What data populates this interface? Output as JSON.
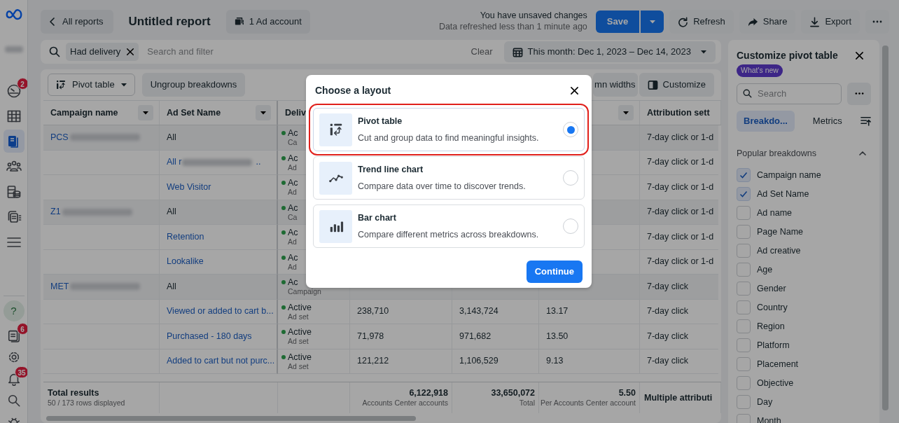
{
  "rail": {
    "top": [
      {
        "selected": false,
        "badge": "2"
      },
      {
        "selected": false
      },
      {
        "selected": true
      },
      {
        "selected": false
      },
      {
        "selected": false
      },
      {
        "selected": false
      },
      {
        "selected": false
      }
    ],
    "help": "?",
    "bottom": [
      {
        "selected": false,
        "badge": "6"
      },
      {
        "selected": false
      },
      {
        "selected": false,
        "badge": "35"
      },
      {
        "selected": false
      },
      {
        "selected": false
      }
    ]
  },
  "header": {
    "back": "All reports",
    "title": "Untitled report",
    "account": "1 Ad account",
    "status": "You have unsaved changes",
    "refreshed": "Data refreshed less than 1 minute ago",
    "save": "Save",
    "actions": [
      "Refresh",
      "Share",
      "Export"
    ]
  },
  "filter": {
    "chips": [
      "Had delivery"
    ],
    "placeholder": "Search and filter",
    "clear": "Clear",
    "date": "This month: Dec 1, 2023 – Dec 14, 2023"
  },
  "toolbar": {
    "layout": "Pivot table",
    "ungroup": "Ungroup breakdowns",
    "widths": "mn widths",
    "customize": "Customize"
  },
  "table": {
    "columns": [
      "Campaign name",
      "Ad Set Name",
      "Deliv",
      "Attribution sett"
    ],
    "rows": [
      {
        "kind": "summary",
        "campaign": "PCS",
        "redacted": true,
        "ad_set": "All",
        "delivery": "Ac",
        "delivery_sub": "Ca",
        "values": [],
        "attribution": "7-day click or 1-d"
      },
      {
        "kind": "adset",
        "ad_set": "All r",
        "ad_set_redacted": true,
        "ad_set_tail": "..",
        "delivery": "Ac",
        "delivery_sub": "Ad",
        "values": [],
        "attribution": "7-day click or 1-d"
      },
      {
        "kind": "adset",
        "ad_set": "Web Visitor",
        "delivery": "Ac",
        "delivery_sub": "Ad",
        "values": [],
        "attribution": "7-day click or 1-d"
      },
      {
        "kind": "summary",
        "campaign": "Z1",
        "redacted": true,
        "ad_set": "All",
        "delivery": "Ac",
        "delivery_sub": "Ca",
        "values": [],
        "attribution": "7-day click or 1-d"
      },
      {
        "kind": "adset",
        "ad_set": "Retention",
        "delivery": "Ac",
        "delivery_sub": "Ad",
        "values": [],
        "attribution": "7-day click or 1-d"
      },
      {
        "kind": "adset",
        "ad_set": "Lookalike",
        "delivery": "Ac",
        "delivery_sub": "Ad",
        "values": [],
        "attribution": "7-day click or 1-d"
      },
      {
        "kind": "summary",
        "campaign": "MET",
        "redacted": true,
        "ad_set": "All",
        "delivery": "Ac",
        "delivery_sub": "Campaign",
        "values": [],
        "attribution": "7-day click"
      },
      {
        "kind": "adset",
        "ad_set": "Viewed or added to cart b...",
        "delivery": "Active",
        "delivery_sub": "Ad set",
        "values": [
          "238,710",
          "3,143,724",
          "13.17"
        ],
        "attribution": "7-day click"
      },
      {
        "kind": "adset",
        "ad_set": "Purchased - 180 days",
        "delivery": "Active",
        "delivery_sub": "Ad set",
        "values": [
          "71,978",
          "971,682",
          "13.50"
        ],
        "attribution": "7-day click"
      },
      {
        "kind": "adset",
        "ad_set": "Added to cart but not purc...",
        "delivery": "Active",
        "delivery_sub": "Ad set",
        "values": [
          "121,212",
          "1,106,529",
          "9.13"
        ],
        "attribution": "7-day click"
      }
    ],
    "totals": {
      "label": "Total results",
      "sub": "50 / 173 rows displayed",
      "cells": [
        {
          "value": "6,122,918",
          "sub": "Accounts Center accounts"
        },
        {
          "value": "33,650,072",
          "sub": "Total"
        },
        {
          "value": "5.50",
          "sub": "Per Accounts Center account"
        }
      ],
      "attribution": "Multiple attributi"
    }
  },
  "panel": {
    "title": "Customize pivot table",
    "badge": "What's new",
    "search_placeholder": "Search",
    "tabs": [
      {
        "label": "Breakdo...",
        "selected": true
      },
      {
        "label": "Metrics",
        "selected": false
      }
    ],
    "section": "Popular breakdowns",
    "expanded": true,
    "breakdowns": [
      {
        "label": "Campaign name",
        "checked": true
      },
      {
        "label": "Ad Set Name",
        "checked": true
      },
      {
        "label": "Ad name",
        "checked": false
      },
      {
        "label": "Page Name",
        "checked": false
      },
      {
        "label": "Ad creative",
        "checked": false
      },
      {
        "label": "Age",
        "checked": false
      },
      {
        "label": "Gender",
        "checked": false
      },
      {
        "label": "Country",
        "checked": false
      },
      {
        "label": "Region",
        "checked": false
      },
      {
        "label": "Platform",
        "checked": false
      },
      {
        "label": "Placement",
        "checked": false
      },
      {
        "label": "Objective",
        "checked": false
      },
      {
        "label": "Day",
        "checked": false
      },
      {
        "label": "Month",
        "checked": false
      }
    ]
  },
  "modal": {
    "title": "Choose a layout",
    "options": [
      {
        "kind": "pivot",
        "title": "Pivot table",
        "description": "Cut and group data to find meaningful insights.",
        "selected": true
      },
      {
        "kind": "trend",
        "title": "Trend line chart",
        "description": "Compare data over time to discover trends.",
        "selected": false
      },
      {
        "kind": "bar",
        "title": "Bar chart",
        "description": "Compare different metrics across breakdowns.",
        "selected": false
      }
    ],
    "button": "Continue"
  }
}
